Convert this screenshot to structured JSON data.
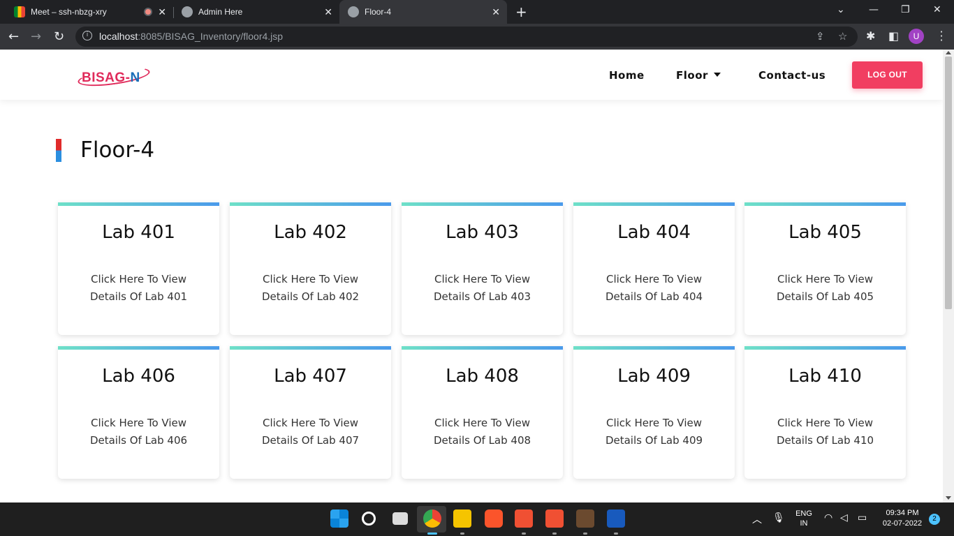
{
  "browser": {
    "tabs": [
      {
        "title": "Meet – ssh-nbzg-xry",
        "active": false
      },
      {
        "title": "Admin Here",
        "active": false
      },
      {
        "title": "Floor-4",
        "active": true
      }
    ],
    "url_host": "localhost",
    "url_rest": ":8085/BISAG_Inventory/floor4.jsp",
    "profile_initial": "U"
  },
  "navbar": {
    "logo_text_a": "BISAG-",
    "logo_text_b": "N",
    "links": {
      "home": "Home",
      "floor": "Floor",
      "contact": "Contact-us"
    },
    "logout_label": "LOG OUT"
  },
  "page": {
    "title": "Floor-4",
    "labs": [
      {
        "name": "Lab 401",
        "desc_line1": "Click Here To View",
        "desc_line2": "Details Of Lab 401"
      },
      {
        "name": "Lab 402",
        "desc_line1": "Click Here To View",
        "desc_line2": "Details Of Lab 402"
      },
      {
        "name": "Lab 403",
        "desc_line1": "Click Here To View",
        "desc_line2": "Details Of Lab 403"
      },
      {
        "name": "Lab 404",
        "desc_line1": "Click Here To View",
        "desc_line2": "Details Of Lab 404"
      },
      {
        "name": "Lab 405",
        "desc_line1": "Click Here To View",
        "desc_line2": "Details Of Lab 405"
      },
      {
        "name": "Lab 406",
        "desc_line1": "Click Here To View",
        "desc_line2": "Details Of Lab 406"
      },
      {
        "name": "Lab 407",
        "desc_line1": "Click Here To View",
        "desc_line2": "Details Of Lab 407"
      },
      {
        "name": "Lab 408",
        "desc_line1": "Click Here To View",
        "desc_line2": "Details Of Lab 408"
      },
      {
        "name": "Lab 409",
        "desc_line1": "Click Here To View",
        "desc_line2": "Details Of Lab 409"
      },
      {
        "name": "Lab 410",
        "desc_line1": "Click Here To View",
        "desc_line2": "Details Of Lab 410"
      }
    ]
  },
  "taskbar": {
    "language_line1": "ENG",
    "language_line2": "IN",
    "time": "09:34 PM",
    "date": "02-07-2022",
    "notification_count": "2"
  },
  "colors": {
    "accent_logout": "#f13e61",
    "card_gradient_start": "#6ee0c8",
    "card_gradient_end": "#4a9aeb"
  }
}
